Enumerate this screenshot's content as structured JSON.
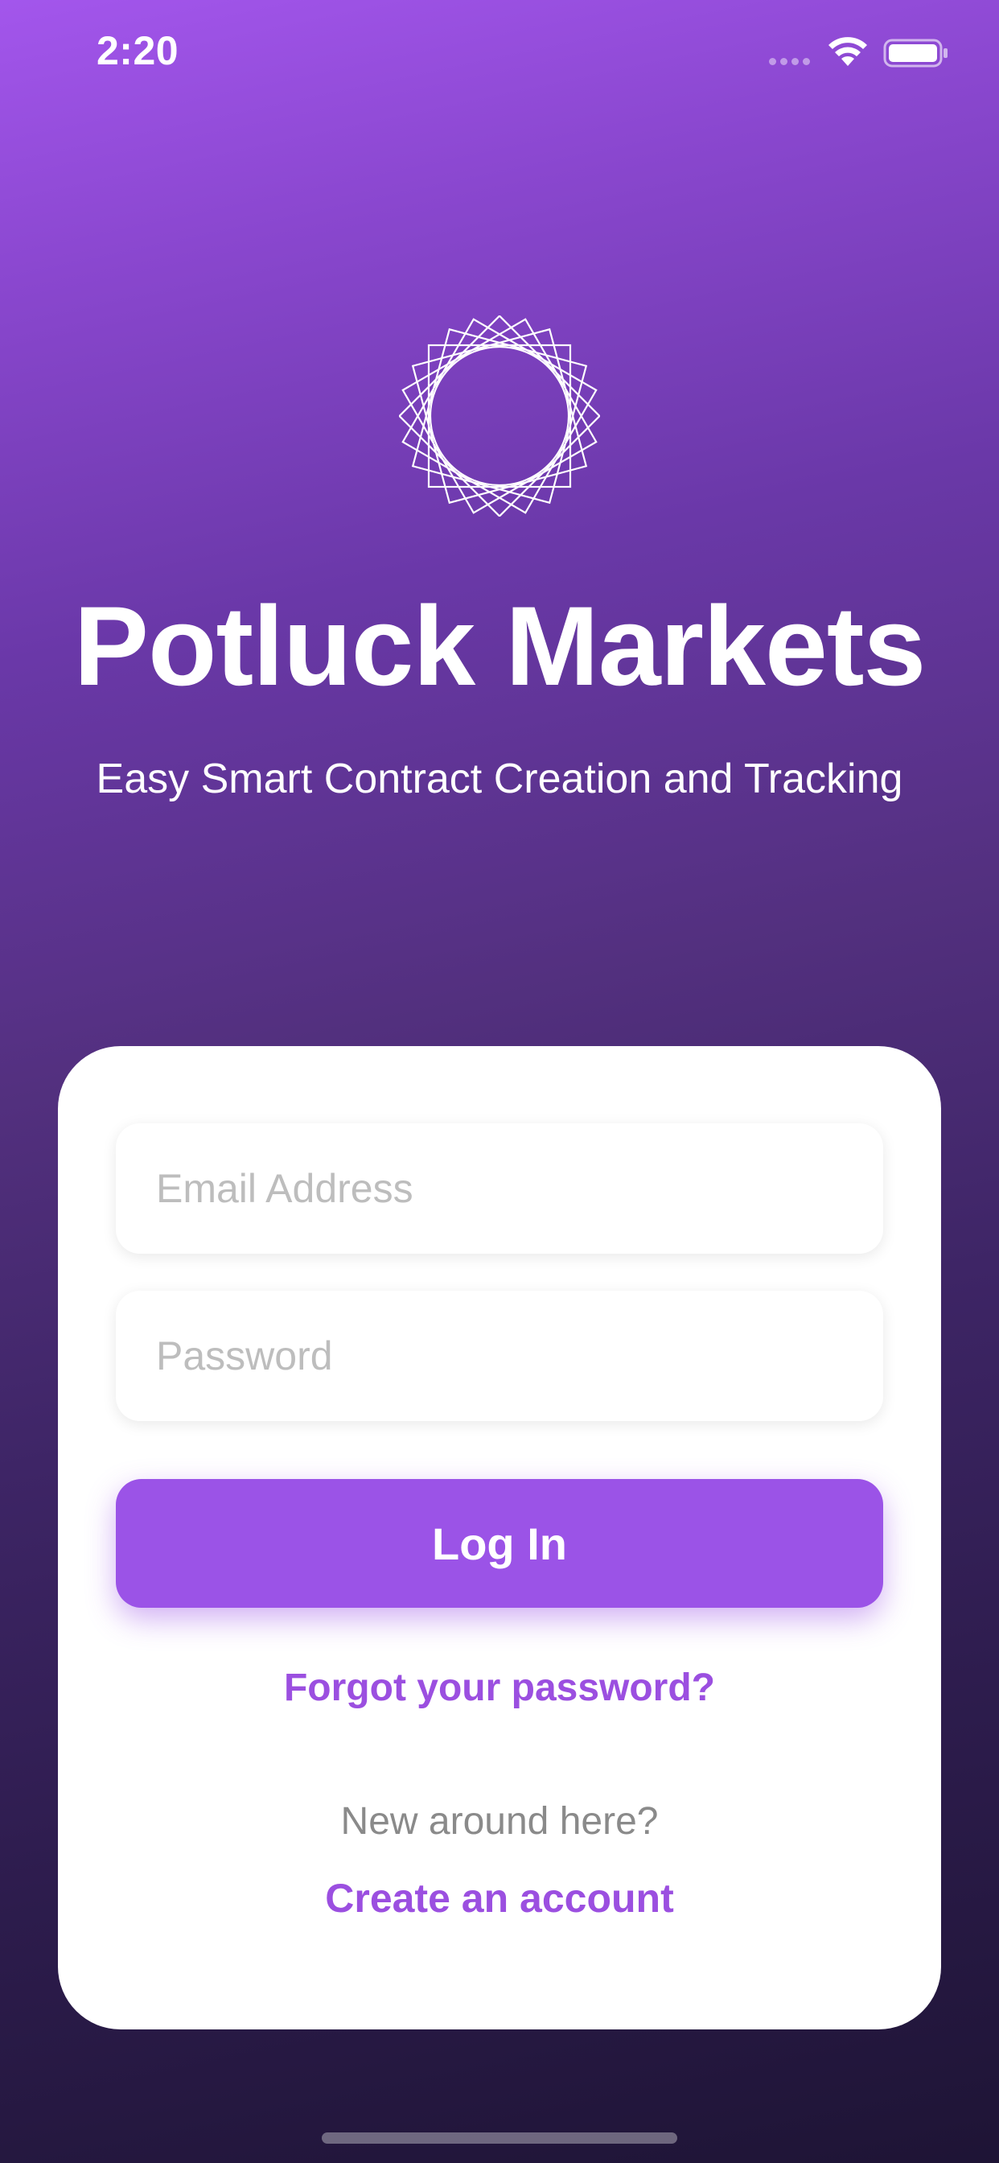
{
  "status_bar": {
    "time": "2:20",
    "icons": [
      "signal-dots-icon",
      "wifi-icon",
      "battery-icon"
    ]
  },
  "hero": {
    "logo_icon": "starburst-logo-icon",
    "title": "Potluck Markets",
    "subtitle": "Easy Smart Contract Creation and Tracking"
  },
  "login": {
    "email_placeholder": "Email Address",
    "email_value": "",
    "password_placeholder": "Password",
    "password_value": "",
    "login_label": "Log In",
    "forgot_label": "Forgot your password?",
    "new_here_label": "New around here?",
    "create_label": "Create an account"
  },
  "colors": {
    "accent": "#9b53e7",
    "link": "#9b4fe0",
    "gradient_top": "#a356ec",
    "gradient_bottom": "#1e1435",
    "card": "#ffffff",
    "placeholder": "#bdbdbd"
  }
}
